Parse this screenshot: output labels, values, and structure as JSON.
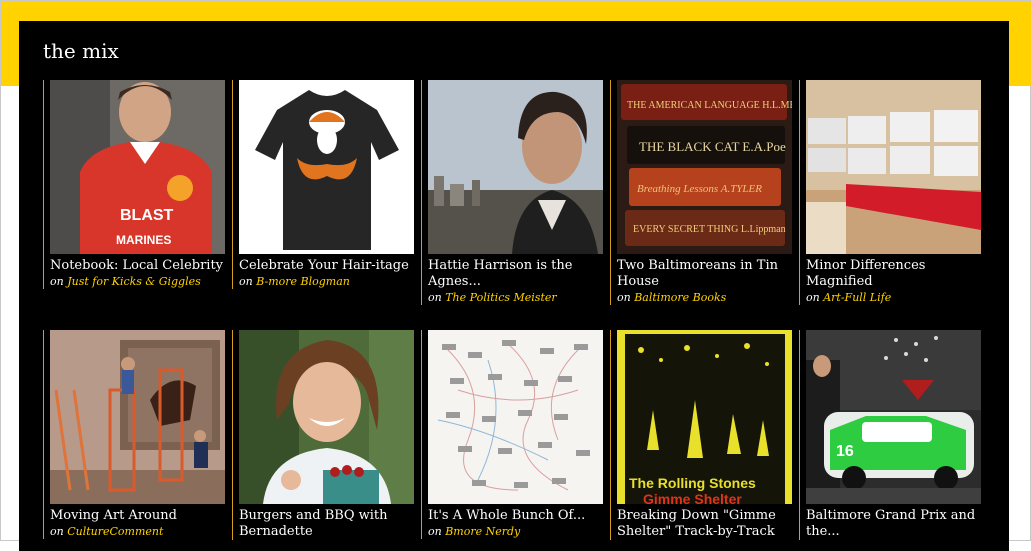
{
  "section_title": "the mix",
  "byline_prefix": "on",
  "items": [
    {
      "title": "Notebook: Local Celebrity",
      "source": "Just for Kicks & Giggles"
    },
    {
      "title": "Celebrate Your Hair-itage",
      "source": "B-more Blogman"
    },
    {
      "title": "Hattie Harrison is the Agnes...",
      "source": "The Politics Meister"
    },
    {
      "title": "Two Baltimoreans in Tin House",
      "source": "Baltimore Books"
    },
    {
      "title": "Minor Differences Magnified",
      "source": "Art-Full Life"
    },
    {
      "title": "Moving Art Around",
      "source": "CultureComment"
    },
    {
      "title": "Burgers and BBQ with Bernadette",
      "source": ""
    },
    {
      "title": "It's A Whole Bunch Of...",
      "source": "Bmore Nerdy"
    },
    {
      "title": "Breaking Down \"Gimme Shelter\" Track-by-Track",
      "source": ""
    },
    {
      "title": "Baltimore Grand Prix and the...",
      "source": ""
    }
  ],
  "thumb_text": {
    "jersey_team": "BLAST",
    "jersey_sponsor": "MARINES",
    "book1": "THE AMERICAN LANGUAGE  H.L.MENCKEN",
    "book2": "THE BLACK CAT  E.A.Poe",
    "book3": "Breathing Lessons  A.TYLER",
    "book4": "EVERY SECRET THING  L.Lippman",
    "album_band": "The Rolling Stones",
    "album_song": "Gimme Shelter",
    "car_number": "16"
  },
  "colors": {
    "accent": "#ffd200",
    "panel": "#000000",
    "divider": "#d4a017"
  }
}
